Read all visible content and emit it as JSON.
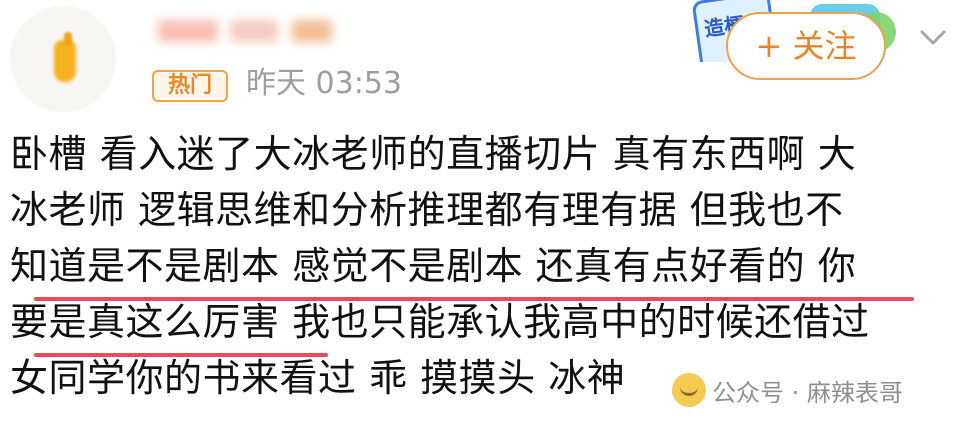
{
  "header": {
    "badge": "热门",
    "time": "昨天 03:53",
    "follow_label": "+ 关注",
    "sticker_text": "造梗"
  },
  "post": {
    "lines": [
      "卧槽 看入迷了大冰老师的直播切片 真有东西啊 大",
      "冰老师 逻辑思维和分析推理都有理有据 但我也不",
      "知道是不是剧本 感觉不是剧本 还真有点好看的 你",
      "要是真这么厉害 我也只能承认我高中的时候还借过",
      "女同学你的书来看过 乖 摸摸头 冰神"
    ],
    "underlined_segments": [
      "知道是不是剧本 感觉不是剧本 还真有点好看的",
      "要是真这么厉害"
    ]
  },
  "watermark": {
    "text": "公众号 · 麻辣表哥"
  },
  "colors": {
    "accent": "#e8832a",
    "underline": "#e94b5e",
    "time": "#9e9e9e"
  },
  "icons": {
    "menu": "chevron-down-icon",
    "watermark": "laughing-emoji-icon"
  }
}
